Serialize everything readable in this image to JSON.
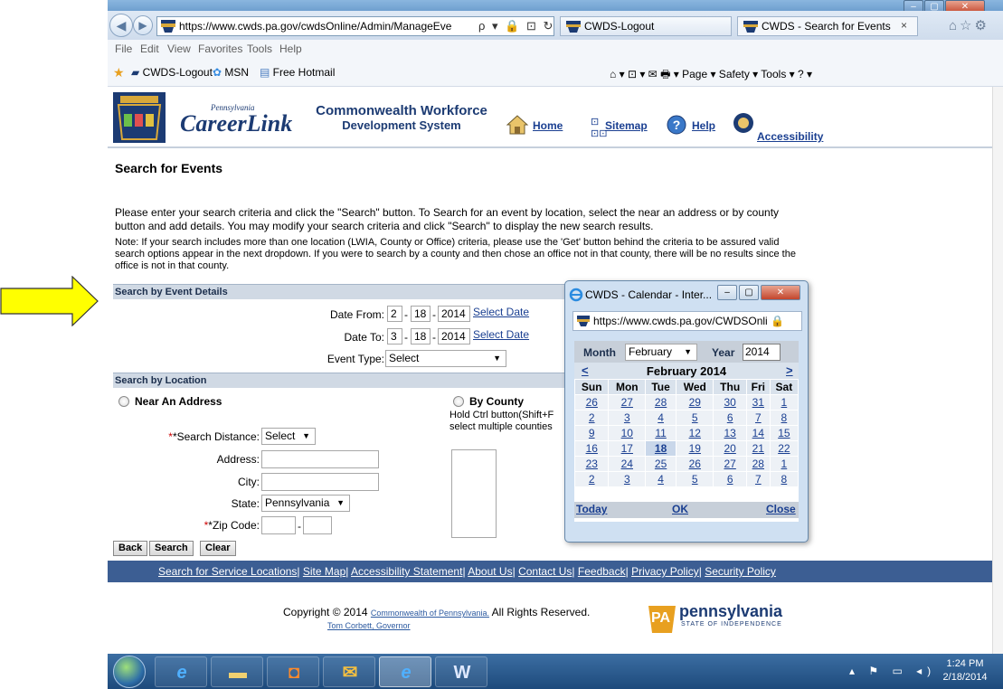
{
  "browser": {
    "title_text": "",
    "address_url": "https://www.cwds.pa.gov/cwdsOnline/Admin/ManageEve",
    "address_tools": "ρ ▾ 🔒 ⊡ ↻ ✕",
    "tabs": [
      {
        "label": "CWDS-Logout"
      },
      {
        "label": "CWDS - Search for Events",
        "close": "×"
      }
    ],
    "nav_right_icons": "⌂☆⚙",
    "menu": [
      "File",
      "Edit",
      "View",
      "Favorites",
      "Tools",
      "Help"
    ],
    "favorites": [
      {
        "label": "CWDS-Logout"
      },
      {
        "label": "MSN"
      },
      {
        "label": "Free Hotmail"
      }
    ],
    "command_bar": "⌂ ▾  ⊡ ▾ ✉  🖶 ▾  Page ▾  Safety ▾  Tools ▾  ? ▾"
  },
  "header": {
    "careerlink_small": "Pennsylvania",
    "careerlink": "CareerLink",
    "system_line1": "Commonwealth Workforce",
    "system_line2": "Development System",
    "links": {
      "home": "Home",
      "sitemap": "Sitemap",
      "help": "Help",
      "accessibility": "Accessibility"
    }
  },
  "page": {
    "title": "Search for Events",
    "intro": "Please enter your search criteria and click the \"Search\" button. To Search for an event by location, select the near an address or by county button and add details. You may modify your search criteria and click \"Search\" to display the new search results.",
    "note": "Note: If your search includes more than one location (LWIA, County or Office) criteria, please use the 'Get' button behind the criteria to be assured valid search options appear in the next dropdown. If you were to search by a county and then chose an office not in that county, there will be no results since the office is not in that county."
  },
  "event_details": {
    "section_title": "Search by Event Details",
    "date_from_label": "Date From:",
    "date_from": {
      "month": "2",
      "day": "18",
      "year": "2014"
    },
    "date_to_label": "Date To:",
    "date_to": {
      "month": "3",
      "day": "18",
      "year": "2014"
    },
    "select_date_link": "Select Date",
    "sep": "-",
    "event_type_label": "Event Type:",
    "event_type_value": "Select"
  },
  "location": {
    "section_title": "Search by Location",
    "near_address_label": "Near An Address",
    "by_county_label": "By County",
    "county_help_1": "Hold Ctrl button(Shift+F",
    "county_help_2": "select multiple counties",
    "distance_label": "*Search Distance:",
    "distance_value": "Select",
    "address_label": "Address:",
    "city_label": "City:",
    "state_label": "State:",
    "state_value": "Pennsylvania",
    "zip_label": "*Zip Code:",
    "zip_sep": "-"
  },
  "buttons": {
    "back": "Back",
    "search": "Search",
    "clear": "Clear"
  },
  "footer": {
    "links": [
      "Search for Service Locations",
      "Site Map",
      "Accessibility Statement",
      "About Us",
      "Contact Us",
      "Feedback",
      "Privacy Policy",
      "Security Policy"
    ],
    "sep": "|",
    "copyright_prefix": "Copyright © 2014",
    "copyright_link": "Commonwealth of Pennsylvania.",
    "copyright_suffix": "All Rights Reserved.",
    "governor": "Tom Corbett, Governor",
    "pa_badge": "PA",
    "pa_word": "pennsylvania",
    "pa_sub": "STATE OF INDEPENDENCE"
  },
  "calendar": {
    "window_title": "CWDS - Calendar - Inter...",
    "address": "https://www.cwds.pa.gov/CWDSOnli",
    "month_label": "Month",
    "month_value": "February",
    "year_label": "Year",
    "year_value": "2014",
    "prev": "<",
    "next": ">",
    "month_title": "February 2014",
    "weekdays": [
      "Sun",
      "Mon",
      "Tue",
      "Wed",
      "Thu",
      "Fri",
      "Sat"
    ],
    "weeks": [
      [
        "26",
        "27",
        "28",
        "29",
        "30",
        "31",
        "1"
      ],
      [
        "2",
        "3",
        "4",
        "5",
        "6",
        "7",
        "8"
      ],
      [
        "9",
        "10",
        "11",
        "12",
        "13",
        "14",
        "15"
      ],
      [
        "16",
        "17",
        "18",
        "19",
        "20",
        "21",
        "22"
      ],
      [
        "23",
        "24",
        "25",
        "26",
        "27",
        "28",
        "1"
      ],
      [
        "2",
        "3",
        "4",
        "5",
        "6",
        "7",
        "8"
      ]
    ],
    "today": "Today",
    "ok": "OK",
    "close": "Close"
  },
  "taskbar": {
    "tray_icons": "▴ ⚑ ▭ ◂)",
    "time": "1:24 PM",
    "date": "2/18/2014"
  },
  "colors": {
    "section_bar": "#d0d9e4",
    "footer_bar": "#3c5e93",
    "link": "#1a3f91",
    "arrow_fill": "#ffff00"
  }
}
